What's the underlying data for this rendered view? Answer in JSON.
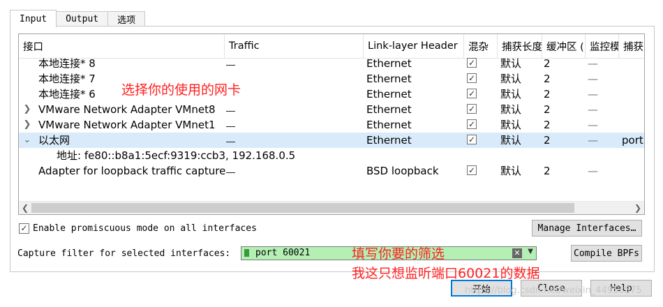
{
  "tabs": [
    {
      "label": "Input"
    },
    {
      "label": "Output"
    },
    {
      "label": "选项"
    }
  ],
  "table": {
    "headers": [
      "接口",
      "Traffic",
      "Link-layer Header",
      "混杂",
      "捕获长度",
      "缓冲区 (",
      "监控模",
      "捕获"
    ],
    "rows": [
      {
        "name": "本地连接* 8",
        "link": "Ethernet",
        "len": "默认",
        "buf": "2",
        "mon": "—",
        "filter": ""
      },
      {
        "name": "本地连接* 7",
        "link": "Ethernet",
        "len": "默认",
        "buf": "2",
        "mon": "—",
        "filter": ""
      },
      {
        "name": "本地连接* 6",
        "link": "Ethernet",
        "len": "默认",
        "buf": "2",
        "mon": "—",
        "filter": ""
      },
      {
        "name": "VMware Network Adapter VMnet8",
        "link": "Ethernet",
        "len": "默认",
        "buf": "2",
        "mon": "—",
        "filter": ""
      },
      {
        "name": "VMware Network Adapter VMnet1",
        "link": "Ethernet",
        "len": "默认",
        "buf": "2",
        "mon": "—",
        "filter": ""
      },
      {
        "name": "以太网",
        "link": "Ethernet",
        "len": "默认",
        "buf": "2",
        "mon": "—",
        "filter": "port"
      },
      {
        "name": "地址: fe80::b8a1:5ecf:9319:ccb3, 192.168.0.5"
      },
      {
        "name": "Adapter for loopback traffic capture",
        "link": "BSD loopback",
        "len": "默认",
        "buf": "2",
        "mon": "—",
        "filter": ""
      }
    ]
  },
  "scroll": {
    "left": "❮",
    "right": "❯"
  },
  "promiscuous": {
    "label": "Enable promiscuous mode on all interfaces",
    "checked": true
  },
  "manage_button": "Manage Interfaces…",
  "capture_filter": {
    "label": "Capture filter for selected interfaces:",
    "value": "port 60021"
  },
  "compile_button": "Compile BPFs",
  "buttons": {
    "start": "开始",
    "close": "Close",
    "help": "Help"
  },
  "annotations": {
    "select_nic": "选择你的使用的网卡",
    "filter_hint1": "填写你要的筛选",
    "filter_hint2": "我这只想监听端口60021的数据"
  },
  "watermark": "https://blog.csdn.net/weixin_44953575",
  "colors": {
    "selection": "#d9ebfa",
    "filter_valid": "#b4f0b4",
    "annotation": "#ff2020",
    "default_button_border": "#0078d7"
  }
}
